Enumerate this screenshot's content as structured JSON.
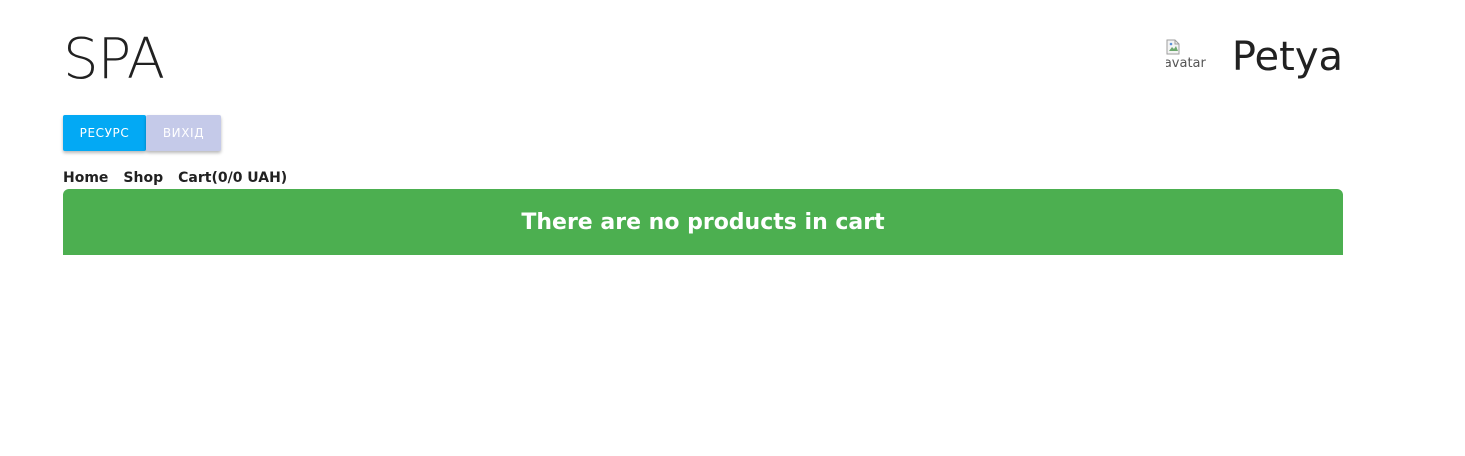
{
  "header": {
    "title": "SPA",
    "user": {
      "avatar_alt": "avatar",
      "name": "Petya"
    }
  },
  "buttons": {
    "resource_label": "РЕСУРС",
    "exit_label": "ВИХІД"
  },
  "nav": {
    "items": [
      {
        "label": "Home"
      },
      {
        "label": "Shop"
      },
      {
        "label": "Cart(0/0 UAH)"
      }
    ]
  },
  "cart": {
    "empty_message": "There are no products in cart"
  },
  "colors": {
    "resource_button": "#03a9f4",
    "exit_button": "#c5cae9",
    "banner": "#4caf50"
  },
  "icons": {
    "avatar": "broken-image-icon"
  }
}
